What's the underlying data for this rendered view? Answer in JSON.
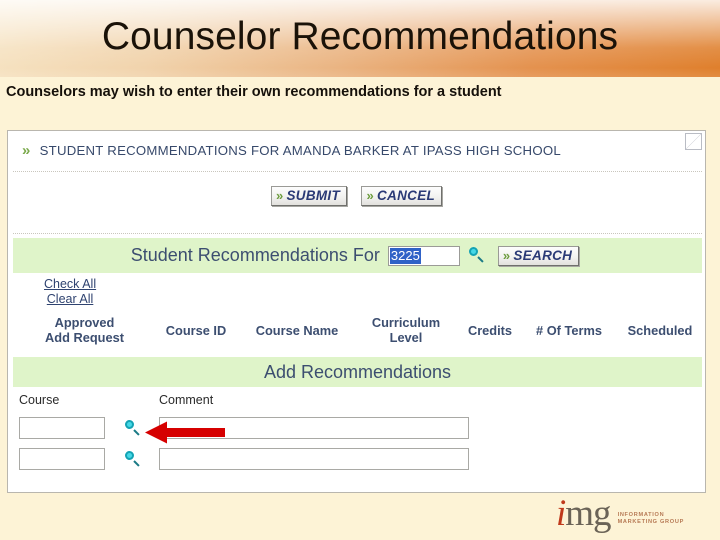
{
  "slide": {
    "title": "Counselor Recommendations",
    "body_text": "Counselors may wish to enter their own recommendations for a student",
    "background_color": "#fdf3d6",
    "title_gradient_from": "#f6e3c2",
    "title_gradient_to": "#df7f2c"
  },
  "app": {
    "chevron": "»",
    "page_title": "STUDENT RECOMMENDATIONS FOR AMANDA BARKER  AT IPASS HIGH SCHOOL",
    "student_name": "AMANDA BARKER",
    "school_name": "IPASS HIGH SCHOOL",
    "actions": {
      "submit_label": "SUBMIT",
      "cancel_label": "CANCEL"
    },
    "search": {
      "label": "Student Recommendations For",
      "value": "3225",
      "placeholder": "",
      "magnifier_icon": "search-icon",
      "button_label": "SEARCH",
      "band_color": "#dff4c9"
    },
    "bulk_links": {
      "check_all": "Check All",
      "clear_all": "Clear All"
    },
    "columns": [
      {
        "id": "approved",
        "line1": "Approved",
        "line2": "Add Request"
      },
      {
        "id": "course_id",
        "line1": "Course ID",
        "line2": ""
      },
      {
        "id": "course_name",
        "line1": "Course Name",
        "line2": ""
      },
      {
        "id": "curriculum_level",
        "line1": "Curriculum",
        "line2": "Level"
      },
      {
        "id": "credits",
        "line1": "Credits",
        "line2": ""
      },
      {
        "id": "num_of_terms",
        "line1": "# Of Terms",
        "line2": ""
      },
      {
        "id": "scheduled",
        "line1": "Scheduled",
        "line2": ""
      }
    ],
    "add_section": {
      "title": "Add Recommendations",
      "course_label": "Course",
      "comment_label": "Comment",
      "rows": [
        {
          "course_value": "",
          "comment_value": ""
        },
        {
          "course_value": "",
          "comment_value": ""
        }
      ]
    },
    "annotation": {
      "type": "arrow",
      "direction": "left",
      "color": "#d60000",
      "points_at": "comment-input-row-1"
    }
  },
  "footer": {
    "logo_mark": "img",
    "logo_line1": "INFORMATION",
    "logo_line2": "MARKETING GROUP"
  }
}
